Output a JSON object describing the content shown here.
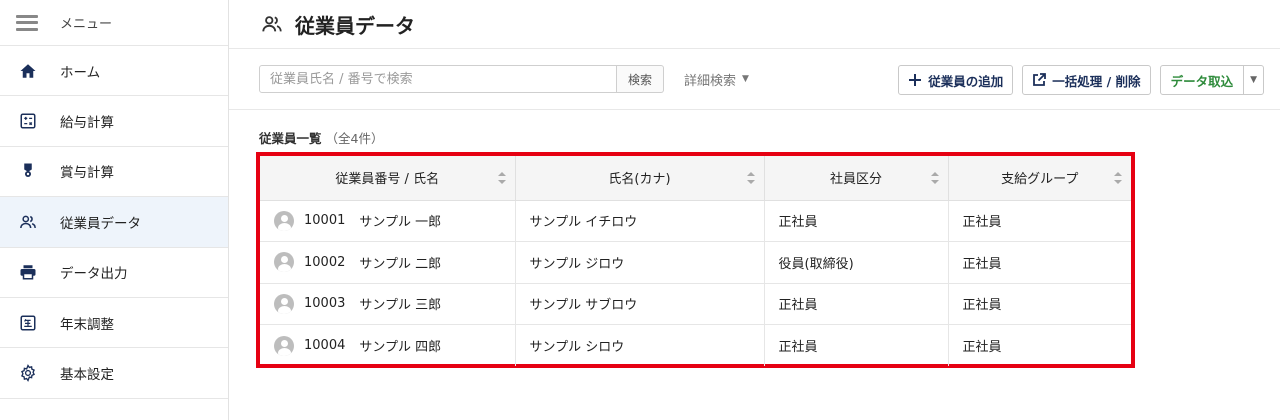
{
  "sidebar": {
    "menu_label": "メニュー",
    "items": [
      {
        "label": "ホーム",
        "icon": "home-icon",
        "active": false
      },
      {
        "label": "給与計算",
        "icon": "calculator-icon",
        "active": false
      },
      {
        "label": "賞与計算",
        "icon": "medal-icon",
        "active": false
      },
      {
        "label": "従業員データ",
        "icon": "people-icon",
        "active": true
      },
      {
        "label": "データ出力",
        "icon": "printer-icon",
        "active": false
      },
      {
        "label": "年末調整",
        "icon": "calendar-year-icon",
        "active": false
      },
      {
        "label": "基本設定",
        "icon": "gear-icon",
        "active": false
      }
    ]
  },
  "header": {
    "title": "従業員データ",
    "icon": "people-icon"
  },
  "toolbar": {
    "search_placeholder": "従業員氏名 / 番号で検索",
    "search_button": "検索",
    "advanced_search": "詳細検索",
    "add_employee": "従業員の追加",
    "bulk_action": "一括処理 / 削除",
    "import_data": "データ取込"
  },
  "list": {
    "caption": "従業員一覧",
    "count": "（全4件）",
    "columns": [
      "従業員番号 / 氏名",
      "氏名(カナ)",
      "社員区分",
      "支給グループ"
    ],
    "rows": [
      {
        "number": "10001",
        "name": "サンプル 一郎",
        "kana": "サンプル イチロウ",
        "type": "正社員",
        "group": "正社員"
      },
      {
        "number": "10002",
        "name": "サンプル 二郎",
        "kana": "サンプル ジロウ",
        "type": "役員(取締役)",
        "group": "正社員"
      },
      {
        "number": "10003",
        "name": "サンプル 三郎",
        "kana": "サンプル サブロウ",
        "type": "正社員",
        "group": "正社員"
      },
      {
        "number": "10004",
        "name": "サンプル 四郎",
        "kana": "サンプル シロウ",
        "type": "正社員",
        "group": "正社員"
      }
    ]
  },
  "colors": {
    "navy": "#1b2f5a",
    "highlight": "#e60012",
    "green": "#2e8b3b",
    "active_bg": "#eef4fb"
  }
}
